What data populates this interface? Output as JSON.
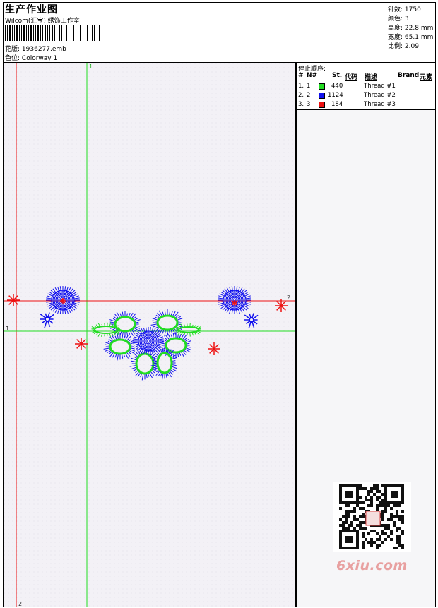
{
  "header": {
    "title": "生产作业图",
    "company": "Wilcom(汇宝) 绣饰工作室",
    "design_file_label": "花版:",
    "design_file": "1936277.emb",
    "colorway_label": "色位:",
    "colorway": "Colorway 1"
  },
  "stats": {
    "stitches_label": "针数:",
    "stitches": "1750",
    "colors_label": "颜色:",
    "colors": "3",
    "height_label": "高度:",
    "height": "22.8 mm",
    "width_label": "宽度:",
    "width": "65.1 mm",
    "ratio_label": "比例:",
    "ratio": "2.09"
  },
  "thread_panel": {
    "title": "停止顺序:",
    "columns": [
      "#",
      "N#",
      "St.",
      "代码",
      "描述",
      "Brand",
      "元素"
    ],
    "rows": [
      {
        "index": "1.",
        "stop": "1",
        "code": "440",
        "color": "#22dd22",
        "description": "Thread #1"
      },
      {
        "index": "2.",
        "stop": "2",
        "code": "1124",
        "color": "#1111ee",
        "description": "Thread #2"
      },
      {
        "index": "3.",
        "stop": "3",
        "code": "184",
        "color": "#ee1111",
        "description": "Thread #3"
      }
    ]
  },
  "guides": {
    "red_vertical": "2",
    "green_vertical": "1",
    "red_horizontal": "2",
    "green_horizontal": "1"
  },
  "colors": {
    "green_thread": "#22dd22",
    "blue_thread": "#1111ee",
    "red_thread": "#ee1111",
    "canvas_bg": "#f3f1f6"
  },
  "watermark": "6xiu.com"
}
